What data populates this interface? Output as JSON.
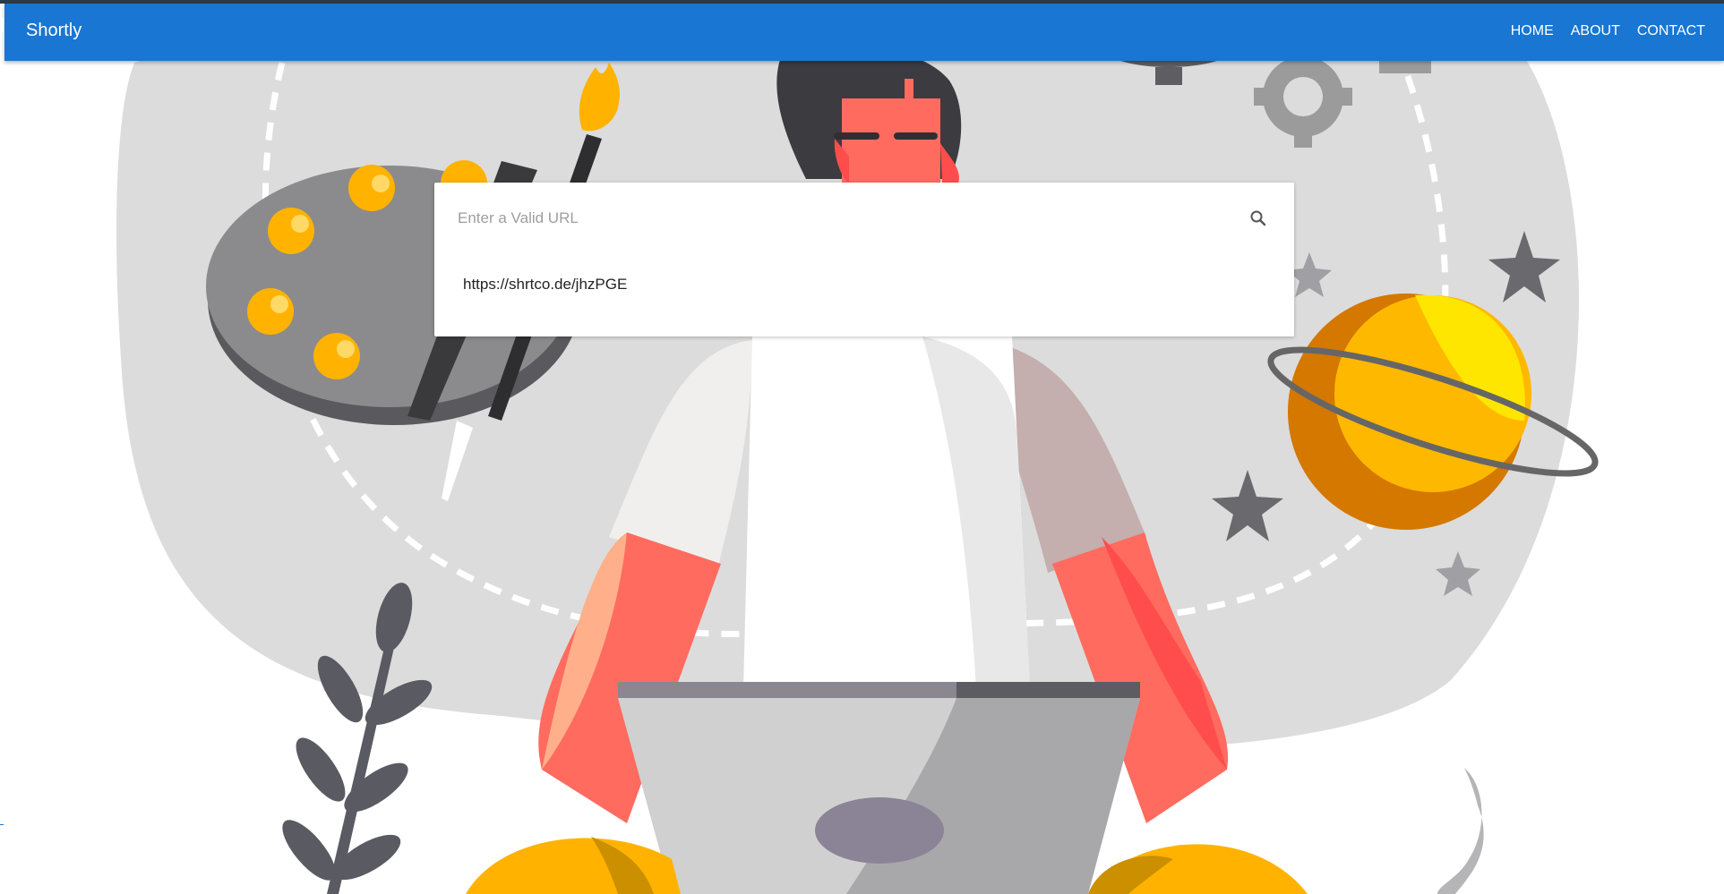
{
  "app": {
    "title": "Shortly"
  },
  "nav": {
    "home": "HOME",
    "about": "ABOUT",
    "contact": "CONTACT"
  },
  "search": {
    "placeholder": "Enter a Valid URL",
    "value": "",
    "icon": "search-icon"
  },
  "result": {
    "short_url": "https://shrtco.de/jhzPGE"
  },
  "colors": {
    "appbar": "#1976d2",
    "accent": "#ffb300",
    "skin": "#ff6b5f",
    "grey_blob": "#dcdcdc"
  }
}
